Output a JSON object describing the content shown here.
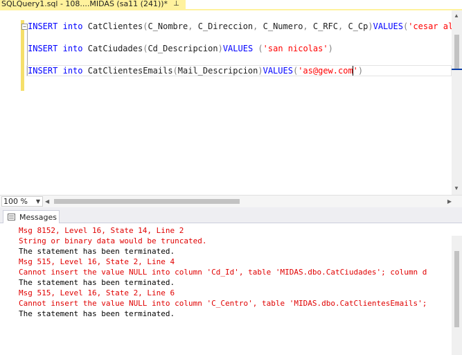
{
  "document_tab": {
    "title": "SQLQuery1.sql - 108....MIDAS (sa11 (241))*",
    "pin_icon": "pin-icon",
    "close_icon": "close-icon"
  },
  "editor": {
    "lines": [
      {
        "tokens": [
          {
            "t": "INSERT",
            "c": "kw"
          },
          {
            "t": " ",
            "c": ""
          },
          {
            "t": "into",
            "c": "kw"
          },
          {
            "t": " CatClientes",
            "c": ""
          },
          {
            "t": "(",
            "c": "gray"
          },
          {
            "t": "C_Nombre",
            "c": ""
          },
          {
            "t": ", ",
            "c": "gray"
          },
          {
            "t": "C_Direccion",
            "c": ""
          },
          {
            "t": ", ",
            "c": "gray"
          },
          {
            "t": "C_Numero",
            "c": ""
          },
          {
            "t": ", ",
            "c": "gray"
          },
          {
            "t": "C_RFC",
            "c": ""
          },
          {
            "t": ", ",
            "c": "gray"
          },
          {
            "t": "C_Cp",
            "c": ""
          },
          {
            "t": ")",
            "c": "gray"
          },
          {
            "t": "VALUES",
            "c": "kw"
          },
          {
            "t": "(",
            "c": "gray"
          },
          {
            "t": "'cesar aleja",
            "c": "str"
          }
        ]
      },
      {
        "tokens": [
          {
            "t": "INSERT",
            "c": "kw"
          },
          {
            "t": " ",
            "c": ""
          },
          {
            "t": "into",
            "c": "kw"
          },
          {
            "t": " CatCiudades",
            "c": ""
          },
          {
            "t": "(",
            "c": "gray"
          },
          {
            "t": "Cd_Descripcion",
            "c": ""
          },
          {
            "t": ")",
            "c": "gray"
          },
          {
            "t": "VALUES",
            "c": "kw"
          },
          {
            "t": " (",
            "c": "gray"
          },
          {
            "t": "'san nicolas'",
            "c": "str"
          },
          {
            "t": ")",
            "c": "gray"
          }
        ]
      },
      {
        "tokens": [
          {
            "t": "INSERT",
            "c": "kw"
          },
          {
            "t": " ",
            "c": ""
          },
          {
            "t": "into",
            "c": "kw"
          },
          {
            "t": " CatClientesEmails",
            "c": ""
          },
          {
            "t": "(",
            "c": "gray"
          },
          {
            "t": "Mail_Descripcion",
            "c": ""
          },
          {
            "t": ")",
            "c": "gray"
          },
          {
            "t": "VALUES",
            "c": "kw"
          },
          {
            "t": "(",
            "c": "gray"
          },
          {
            "t": "'as@gew.com'",
            "c": "str"
          },
          {
            "t": ")",
            "c": "gray"
          }
        ]
      }
    ]
  },
  "zoom": {
    "value": "100 %"
  },
  "results": {
    "tab_label": "Messages",
    "tab_icon": "messages-icon",
    "messages": [
      {
        "text": "Msg 8152, Level 16, State 14, Line 2",
        "type": "err"
      },
      {
        "text": "String or binary data would be truncated.",
        "type": "err"
      },
      {
        "text": "The statement has been terminated.",
        "type": "info"
      },
      {
        "text": "Msg 515, Level 16, State 2, Line 4",
        "type": "err"
      },
      {
        "text": "Cannot insert the value NULL into column 'Cd_Id', table 'MIDAS.dbo.CatCiudades'; column d",
        "type": "err"
      },
      {
        "text": "The statement has been terminated.",
        "type": "info"
      },
      {
        "text": "Msg 515, Level 16, State 2, Line 6",
        "type": "err"
      },
      {
        "text": "Cannot insert the value NULL into column 'C_Centro', table 'MIDAS.dbo.CatClientesEmails';",
        "type": "err"
      },
      {
        "text": "The statement has been terminated.",
        "type": "info"
      }
    ]
  },
  "colors": {
    "keyword": "#0000ff",
    "string": "#ff0000",
    "error": "#e00000",
    "tab_highlight": "#fff29d"
  }
}
